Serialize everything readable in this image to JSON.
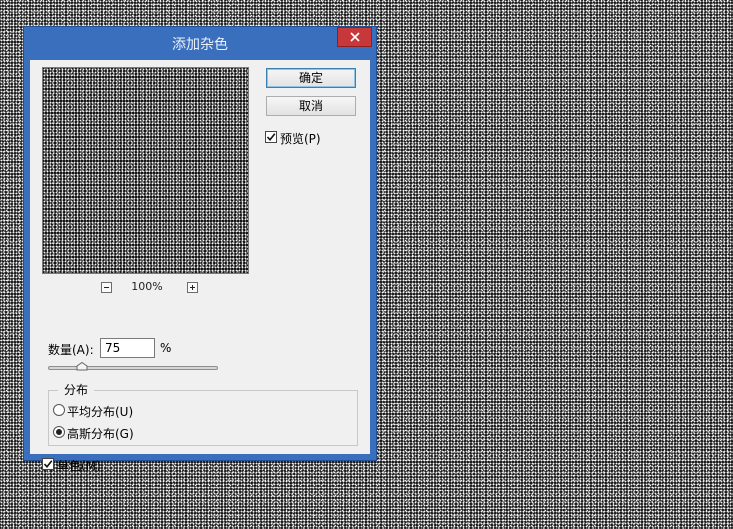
{
  "dialog": {
    "title": "添加杂色",
    "ok_label": "确定",
    "cancel_label": "取消",
    "preview_label": "预览(P)",
    "preview_checked": true
  },
  "preview": {
    "zoom_label": "100%"
  },
  "amount": {
    "label": "数量(A):",
    "value": "75",
    "unit": "%",
    "slider_fraction": 0.2
  },
  "distribution": {
    "group_label": "分布",
    "options": [
      {
        "label": "平均分布(U)",
        "selected": false
      },
      {
        "label": "高斯分布(G)",
        "selected": true
      }
    ]
  },
  "monochromatic": {
    "label": "单色(M)",
    "checked": true
  },
  "colors": {
    "title_bar": "#3a6fbe",
    "close_button": "#c7383a",
    "dialog_bg": "#f0f0f0"
  }
}
